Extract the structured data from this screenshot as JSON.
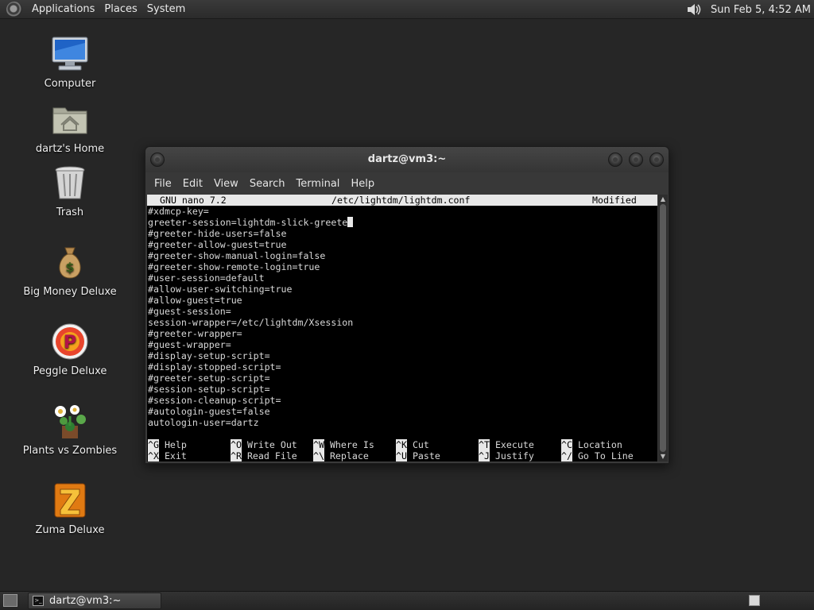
{
  "top_panel": {
    "menus": [
      "Applications",
      "Places",
      "System"
    ],
    "clock": "Sun Feb  5,  4:52 AM"
  },
  "desktop_icons": [
    {
      "label": "Computer",
      "icon": "computer-icon"
    },
    {
      "label": "dartz's Home",
      "icon": "home-folder-icon"
    },
    {
      "label": "Trash",
      "icon": "trash-icon"
    },
    {
      "label": "Big Money Deluxe",
      "icon": "money-bag-icon"
    },
    {
      "label": "Peggle Deluxe",
      "icon": "peggle-icon"
    },
    {
      "label": "Plants vs Zombies",
      "icon": "plants-vs-zombies-icon"
    },
    {
      "label": "Zuma Deluxe",
      "icon": "zuma-icon"
    }
  ],
  "window": {
    "title": "dartz@vm3:~",
    "menu": [
      "File",
      "Edit",
      "View",
      "Search",
      "Terminal",
      "Help"
    ]
  },
  "nano": {
    "version": "GNU nano 7.2",
    "filename": "/etc/lightdm/lightdm.conf",
    "status": "Modified",
    "lines": [
      "#xdmcp-key=",
      "greeter-session=lightdm-slick-greete",
      "#greeter-hide-users=false",
      "#greeter-allow-guest=true",
      "#greeter-show-manual-login=false",
      "#greeter-show-remote-login=true",
      "#user-session=default",
      "#allow-user-switching=true",
      "#allow-guest=true",
      "#guest-session=",
      "session-wrapper=/etc/lightdm/Xsession",
      "#greeter-wrapper=",
      "#guest-wrapper=",
      "#display-setup-script=",
      "#display-stopped-script=",
      "#greeter-setup-script=",
      "#session-setup-script=",
      "#session-cleanup-script=",
      "#autologin-guest=false",
      "autologin-user=dartz"
    ],
    "shortcuts": [
      [
        {
          "key": "^G",
          "label": "Help"
        },
        {
          "key": "^O",
          "label": "Write Out"
        },
        {
          "key": "^W",
          "label": "Where Is"
        },
        {
          "key": "^K",
          "label": "Cut"
        },
        {
          "key": "^T",
          "label": "Execute"
        },
        {
          "key": "^C",
          "label": "Location"
        }
      ],
      [
        {
          "key": "^X",
          "label": "Exit"
        },
        {
          "key": "^R",
          "label": "Read File"
        },
        {
          "key": "^\\",
          "label": "Replace"
        },
        {
          "key": "^U",
          "label": "Paste"
        },
        {
          "key": "^J",
          "label": "Justify"
        },
        {
          "key": "^/",
          "label": "Go To Line"
        }
      ]
    ]
  },
  "taskbar": {
    "task_label": "dartz@vm3:~"
  }
}
